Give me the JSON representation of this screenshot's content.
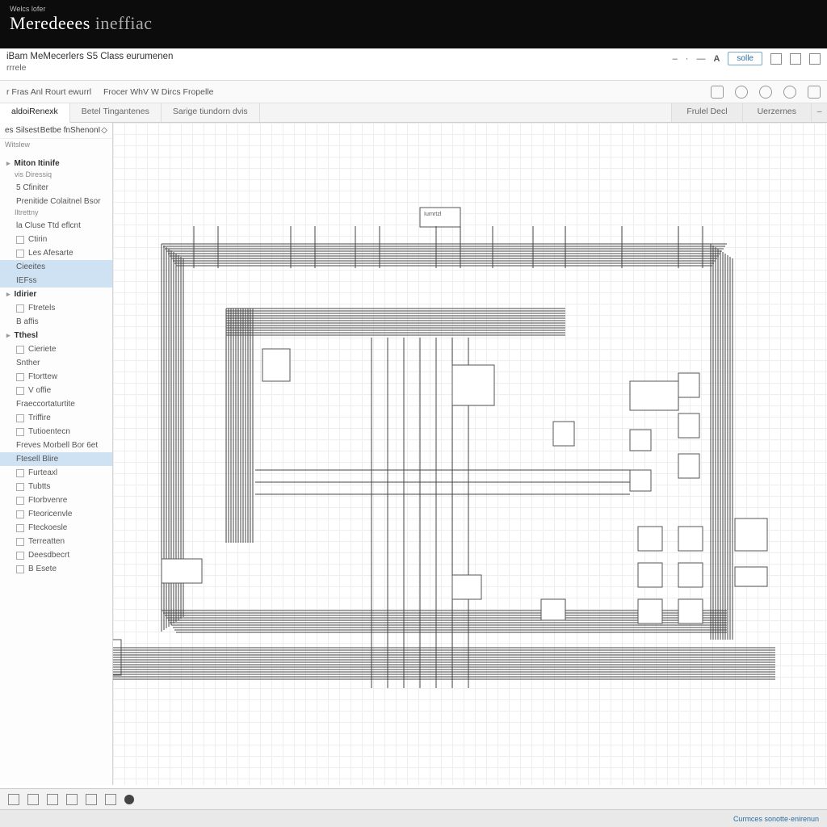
{
  "titlebar": {
    "small_text": "Welcs lofer",
    "brand_a": "Meredeees",
    "brand_b": "ineffiac"
  },
  "docbar": {
    "line1": "iBam MeMecerlers S5 Class eurumenen",
    "line2": "rrrele",
    "btn": "solle"
  },
  "toolbar": {
    "item1": "r Fras Anl Rourt ewurrl",
    "item2": "Frocer WhV W Dircs Fropelle"
  },
  "tabs": {
    "t1": "aldoiRenexk",
    "t2": "Betel Tingantenes",
    "t3": "Sarige tiundorn dvis",
    "r1": "Frulel Decl",
    "r2": "Uerzernes"
  },
  "sidebar": {
    "hd_a": "es Silsest",
    "hd_b": "Betbe fnShenonI",
    "hd2": "Witslew",
    "items": [
      {
        "label": "Miton Itinife",
        "bold": true
      },
      {
        "label": "vis Diressiq",
        "sub": true
      },
      {
        "label": "5 Cfiniter"
      },
      {
        "label": "Prenitide Colaitnel Bsor"
      },
      {
        "label": "Iltrettny",
        "sub": true
      },
      {
        "label": "la Cluse Ttd eflcnt"
      },
      {
        "label": "Ctirin",
        "icon": true
      },
      {
        "label": "Les Afesarte",
        "icon": true
      },
      {
        "label": "Cieeites",
        "sel": true
      },
      {
        "label": "IEFss",
        "sel": true
      },
      {
        "label": "Idirier",
        "bold": true
      },
      {
        "label": "Ftretels",
        "icon": true
      },
      {
        "label": "B affis"
      },
      {
        "label": "Tthesl",
        "bold": true
      },
      {
        "label": "Cieriete",
        "icon": true
      },
      {
        "label": "Snther"
      },
      {
        "label": "Ftorttew",
        "icon": true
      },
      {
        "label": "V offie",
        "icon": true
      },
      {
        "label": "Fraeccortaturtite"
      },
      {
        "label": "Triffire",
        "icon": true
      },
      {
        "label": "Tutioentecn",
        "icon": true
      },
      {
        "label": "Freves Morbell Bor 6et"
      },
      {
        "label": "Ftesell Blire",
        "sel": true
      },
      {
        "label": "Furteaxl",
        "icon": true
      },
      {
        "label": "Tubtts",
        "icon": true
      },
      {
        "label": "Ftorbvenre",
        "icon": true
      },
      {
        "label": "Fteoricenvle",
        "icon": true
      },
      {
        "label": "Fteckoesle",
        "icon": true
      },
      {
        "label": "Terreatten",
        "icon": true
      },
      {
        "label": "Deesdbecrt",
        "icon": true
      },
      {
        "label": "B Esete",
        "icon": true
      }
    ]
  },
  "diagram": {
    "block_label": "Iurnrtzl"
  },
  "footer": {
    "link": "Curmces sonotte·enirenun"
  }
}
